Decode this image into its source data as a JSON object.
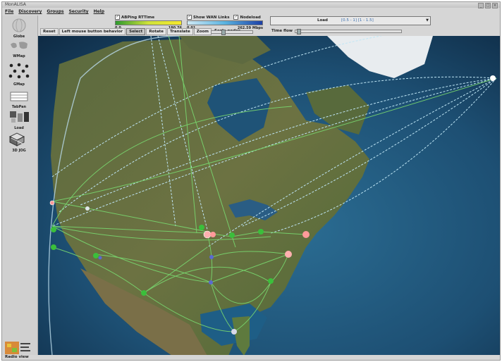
{
  "window": {
    "title": "MonALISA"
  },
  "menu": [
    "File",
    "Discovery",
    "Groups",
    "Security",
    "Help"
  ],
  "controls": {
    "abping": {
      "label": "ABPing RTTime",
      "min": "0.0",
      "max": "180.76",
      "checked": true
    },
    "show_wan": {
      "label": "Show WAN Links",
      "checked": true
    },
    "nodeload": {
      "label": "Nodeload",
      "checked": true
    },
    "bandwidth": {
      "min": "0.01",
      "max": "262.59 Mbps"
    },
    "legend": {
      "label": "Load",
      "value": "[0.5 - 1] [1 - 1.5]"
    }
  },
  "toolbar": {
    "reset": "Reset",
    "left_mouse": "Left mouse button behavior",
    "select": "Select",
    "rotate": "Rotate",
    "translate": "Translate",
    "zoom": "Zoom",
    "scale_nodes": "Scale nodes",
    "time_flow": "Time flow"
  },
  "sidebar": [
    {
      "label": "Globe",
      "icon": "globe-icon"
    },
    {
      "label": "WMap",
      "icon": "world-map-icon"
    },
    {
      "label": "GMap",
      "icon": "graph-map-icon"
    },
    {
      "label": "TabPan",
      "icon": "table-panel-icon"
    },
    {
      "label": "Load",
      "icon": "load-icon"
    },
    {
      "label": "3D JOG",
      "icon": "3d-cube-icon"
    }
  ],
  "status": {
    "label": "Radio view"
  },
  "colors": {
    "link": "#6fd36a",
    "wan": "#bde6f2",
    "node": "#3bbf3b",
    "highlight": "#ff9a9a"
  }
}
